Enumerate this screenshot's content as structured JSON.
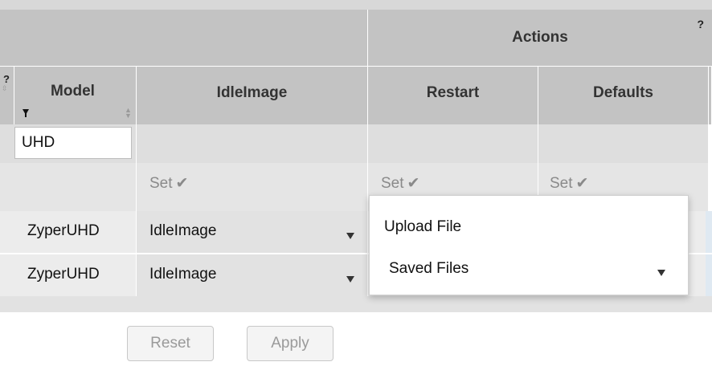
{
  "group_header": {
    "title": "Actions",
    "help": "?"
  },
  "left_header": {
    "help": "?",
    "sort": "⇳"
  },
  "columns": {
    "model": "Model",
    "idle_image": "IdleImage",
    "restart": "Restart",
    "defaults": "Defaults"
  },
  "filter": {
    "model_value": "UHD"
  },
  "set_row": {
    "label": "Set",
    "check": "✔"
  },
  "rows": [
    {
      "model": "ZyperUHD",
      "idle_image": "IdleImage"
    },
    {
      "model": "ZyperUHD",
      "idle_image": "IdleImage"
    }
  ],
  "popup": {
    "upload": "Upload File",
    "saved": "Saved Files"
  },
  "buttons": {
    "reset": "Reset",
    "apply": "Apply"
  },
  "colors": {
    "header": "#c3c3c3",
    "filter_row": "#dedede",
    "row": "#ececec",
    "muted_text": "#8a8a8a"
  }
}
